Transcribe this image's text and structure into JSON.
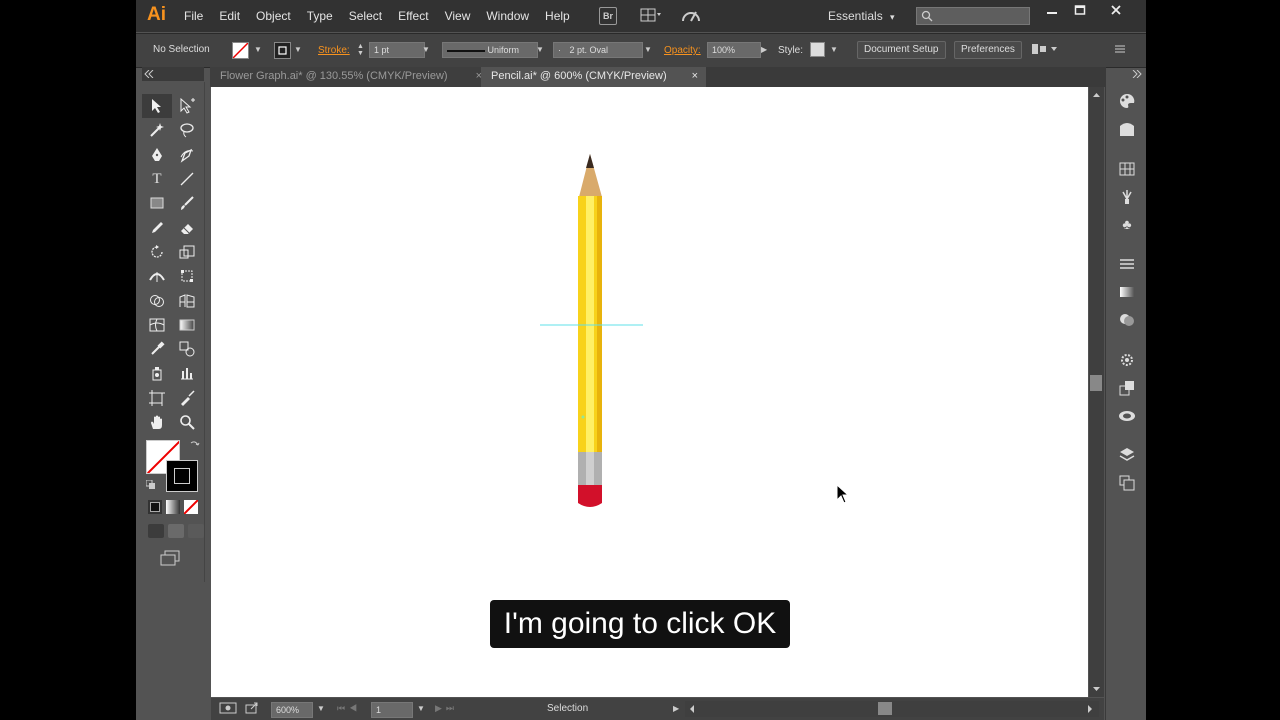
{
  "menubar": {
    "logo": "Ai",
    "items": [
      "File",
      "Edit",
      "Object",
      "Type",
      "Select",
      "Effect",
      "View",
      "Window",
      "Help"
    ],
    "bridge": "Br",
    "workspace": "Essentials",
    "workspace_arrow": "▾"
  },
  "control_bar": {
    "selection": "No Selection",
    "stroke_label": "Stroke:",
    "stroke_weight": "1 pt",
    "profile": "Uniform",
    "brush": "2 pt. Oval",
    "opacity_label": "Opacity:",
    "opacity": "100%",
    "style_label": "Style:",
    "document_setup": "Document Setup",
    "preferences": "Preferences"
  },
  "tabs": [
    {
      "label": "Flower Graph.ai* @ 130.55% (CMYK/Preview)",
      "close": "×"
    },
    {
      "label": "Pencil.ai* @ 600% (CMYK/Preview)",
      "close": "×"
    }
  ],
  "status_bar": {
    "zoom": "600%",
    "artboard": "1",
    "tool": "Selection"
  },
  "caption": "I'm going to click OK",
  "colors": {
    "pencil_body": "#f8d21b",
    "pencil_highlight": "#fff066",
    "pencil_shadow": "#e8b30c",
    "wood": "#d9aa6b",
    "lead": "#3a2a20",
    "ferrule": "#b0b0b0",
    "eraser": "#d2102a",
    "guide": "#5fe0e8",
    "accent": "#f7921e"
  }
}
